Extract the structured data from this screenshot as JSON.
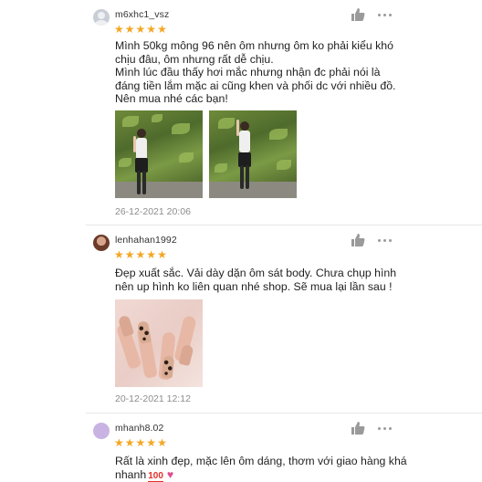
{
  "reviews": [
    {
      "username": "m6xhc1_vsz",
      "rating": 5,
      "comment_lines": [
        "Mình 50kg mông 96 nên ôm nhưng ôm ko phải kiểu khó",
        "chịu đâu, ôm nhưng rất dễ chịu.",
        "Mình lúc đầu thấy hơi mắc nhưng nhận đc phải nói là",
        "đáng tiền lắm mặc ai cũng khen và phối dc với nhiều đồ.",
        "Nên mua nhé các bạn!"
      ],
      "timestamp": "26-12-2021 20:06",
      "avatar_icon": "default-user-icon",
      "photo_count": 2
    },
    {
      "username": "lenhahan1992",
      "rating": 5,
      "comment_lines": [
        "Đẹp xuất sắc. Vải dày dặn ôm sát body. Chưa chụp hình",
        "nên up hình ko liên quan nhé shop. Sẽ mua lại lần sau !"
      ],
      "timestamp": "20-12-2021 12:12",
      "avatar_icon": "user-photo-avatar",
      "photo_count": 1
    },
    {
      "username": "mhanh8.02",
      "rating": 5,
      "comment_lines": [
        "Rất là xinh đẹp, mặc lên ôm dáng, thơm với giao hàng khá",
        "nhanh"
      ],
      "emoji": [
        "100",
        "♥"
      ],
      "avatar_icon": "purple-avatar",
      "photo_count": 0
    }
  ],
  "icons": {
    "like": "thumbs-up-icon",
    "more": "more-options-icon",
    "star": "star-icon"
  },
  "colors": {
    "star": "#f5a623",
    "icon": "#9a9a9a",
    "divider": "#e8e8e8"
  }
}
